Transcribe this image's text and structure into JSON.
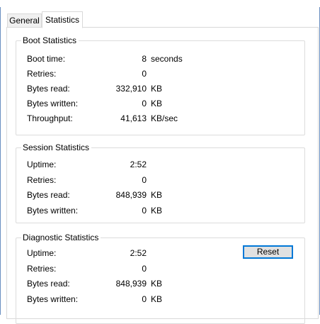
{
  "window": {
    "title": ""
  },
  "tabs": [
    {
      "label": "General",
      "active": false
    },
    {
      "label": "Statistics",
      "active": true
    }
  ],
  "boot": {
    "title": "Boot Statistics",
    "rows": [
      {
        "label": "Boot time:",
        "value": "8",
        "unit": "seconds"
      },
      {
        "label": "Retries:",
        "value": "0",
        "unit": ""
      },
      {
        "label": "Bytes read:",
        "value": "332,910",
        "unit": "KB"
      },
      {
        "label": "Bytes written:",
        "value": "0",
        "unit": "KB"
      },
      {
        "label": "Throughput:",
        "value": "41,613",
        "unit": "KB/sec"
      }
    ]
  },
  "session": {
    "title": "Session Statistics",
    "rows": [
      {
        "label": "Uptime:",
        "value": "2:52",
        "unit": ""
      },
      {
        "label": "Retries:",
        "value": "0",
        "unit": ""
      },
      {
        "label": "Bytes read:",
        "value": "848,939",
        "unit": "KB"
      },
      {
        "label": "Bytes written:",
        "value": "0",
        "unit": "KB"
      }
    ]
  },
  "diagnostic": {
    "title": "Diagnostic Statistics",
    "reset_label": "Reset",
    "rows": [
      {
        "label": "Uptime:",
        "value": "2:52",
        "unit": ""
      },
      {
        "label": "Retries:",
        "value": "0",
        "unit": ""
      },
      {
        "label": "Bytes read:",
        "value": "848,939",
        "unit": "KB"
      },
      {
        "label": "Bytes written:",
        "value": "0",
        "unit": "KB"
      }
    ]
  }
}
